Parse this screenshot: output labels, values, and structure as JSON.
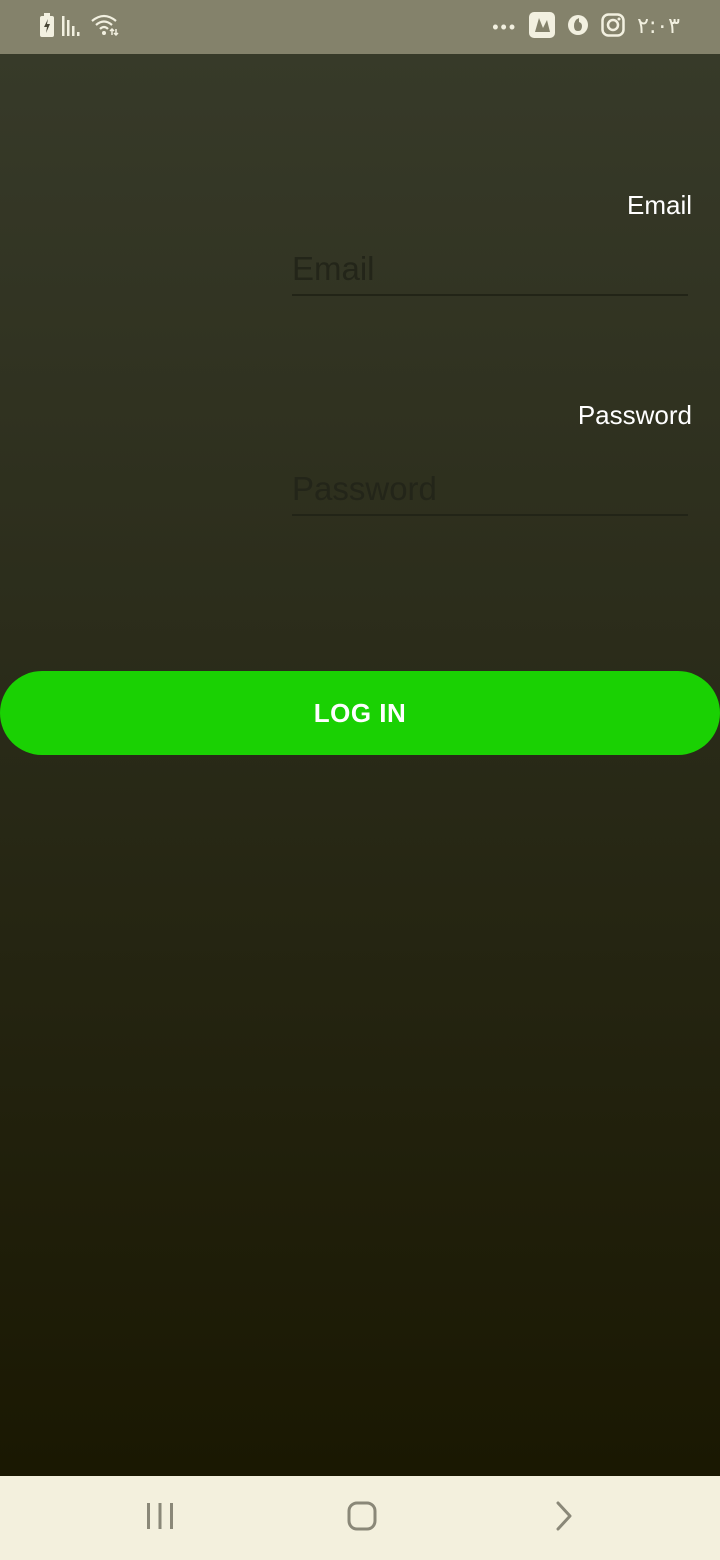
{
  "status_bar": {
    "time": "٢:٠٣",
    "more_indicator": "•••",
    "icons_left": [
      "battery-charging-icon",
      "signal-icon",
      "wifi-icon"
    ],
    "icons_right": [
      "app-notification-icon",
      "vodafone-icon",
      "instagram-icon"
    ]
  },
  "form": {
    "email_label": "Email",
    "email_placeholder": "Email",
    "email_value": "",
    "password_label": "Password",
    "password_placeholder": "Password",
    "password_value": ""
  },
  "login_button": {
    "label": "LOG IN",
    "color": "#1ad103"
  },
  "nav_bar": {
    "icons": [
      "recents-icon",
      "home-icon",
      "back-icon"
    ]
  },
  "colors": {
    "background_top": "#373a29",
    "background_bottom": "#1a1802",
    "status_bar": "#84826b",
    "nav_bar": "#f3f0dd"
  }
}
